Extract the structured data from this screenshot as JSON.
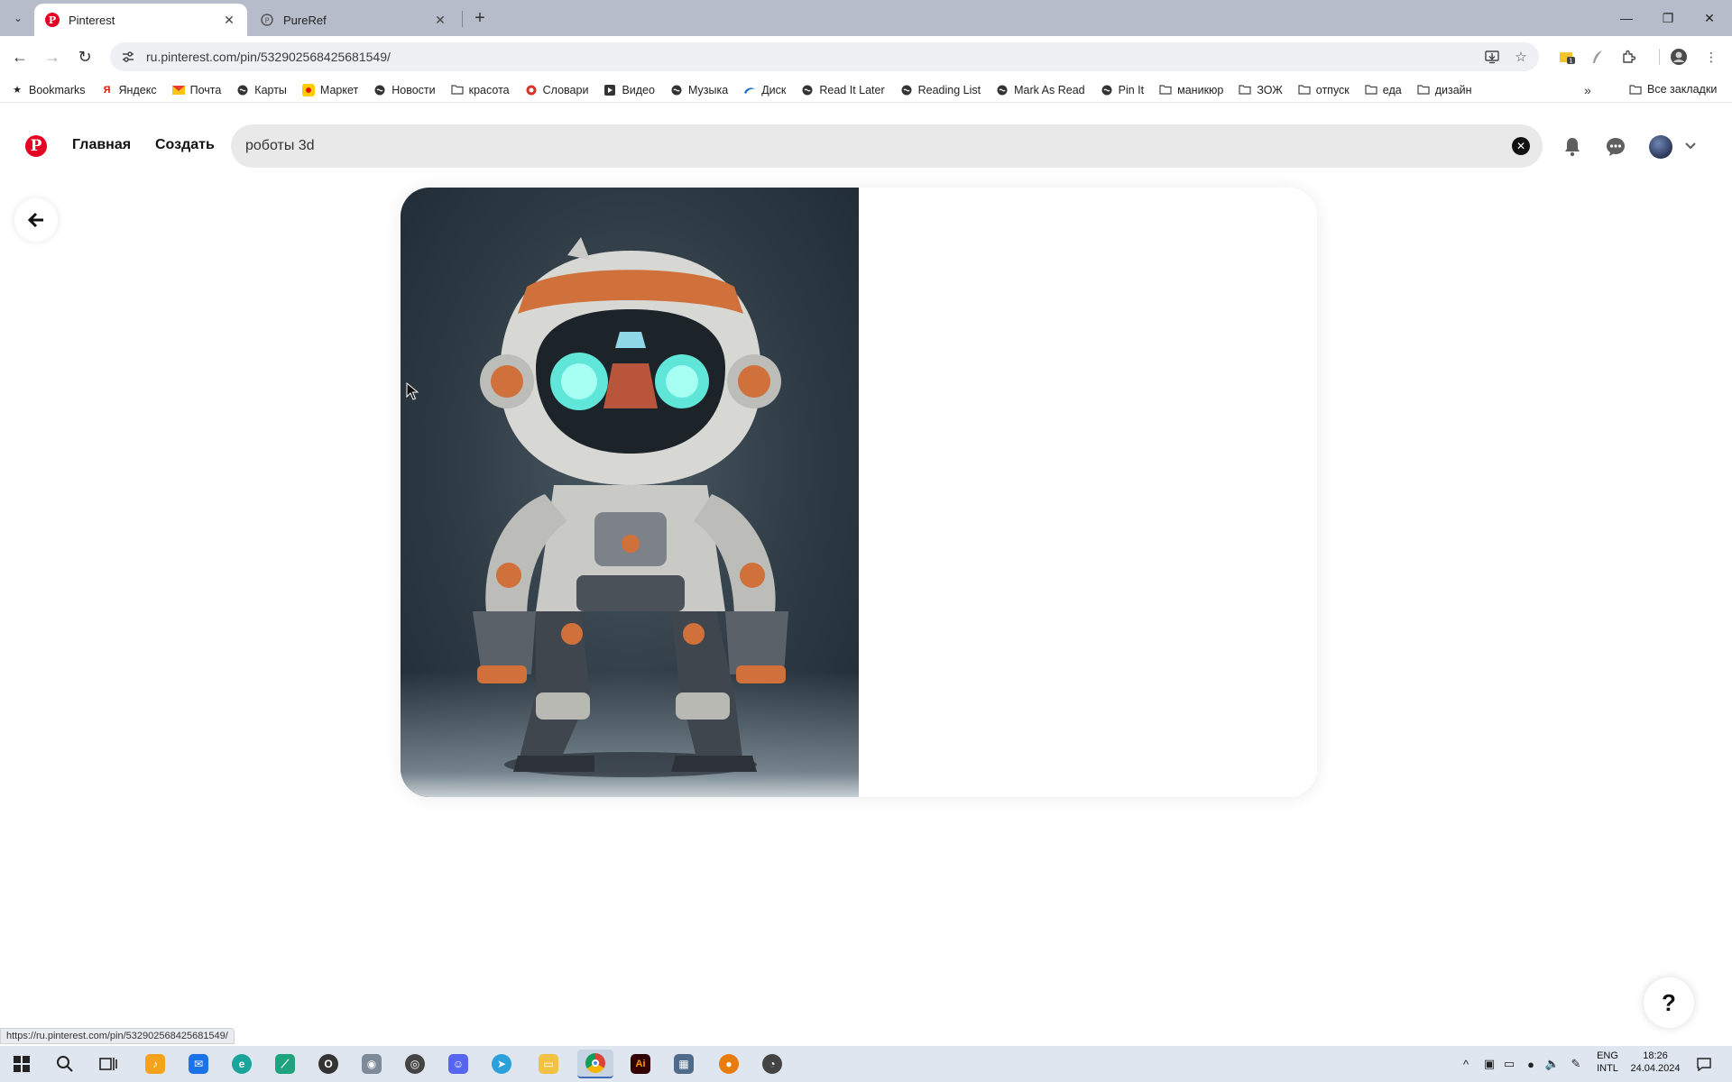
{
  "browser": {
    "tabs": [
      {
        "title": "Pinterest",
        "active": true
      },
      {
        "title": "PureRef",
        "active": false
      }
    ],
    "url": "ru.pinterest.com/pin/532902568425681549/",
    "bookmarks": [
      {
        "label": "Bookmarks",
        "icon": "star-icon"
      },
      {
        "label": "Яндекс",
        "icon": "yandex-icon"
      },
      {
        "label": "Почта",
        "icon": "mail-icon"
      },
      {
        "label": "Карты",
        "icon": "globe-icon"
      },
      {
        "label": "Маркет",
        "icon": "market-icon"
      },
      {
        "label": "Новости",
        "icon": "globe-icon"
      },
      {
        "label": "красота",
        "icon": "folder-icon"
      },
      {
        "label": "Словари",
        "icon": "dictionary-icon"
      },
      {
        "label": "Видео",
        "icon": "video-icon"
      },
      {
        "label": "Музыка",
        "icon": "globe-icon"
      },
      {
        "label": "Диск",
        "icon": "disk-icon"
      },
      {
        "label": "Read It Later",
        "icon": "globe-icon"
      },
      {
        "label": "Reading List",
        "icon": "globe-icon"
      },
      {
        "label": "Mark As Read",
        "icon": "globe-icon"
      },
      {
        "label": "Pin It",
        "icon": "globe-icon"
      },
      {
        "label": "маникюр",
        "icon": "folder-icon"
      },
      {
        "label": "ЗОЖ",
        "icon": "folder-icon"
      },
      {
        "label": "отпуск",
        "icon": "folder-icon"
      },
      {
        "label": "еда",
        "icon": "folder-icon"
      },
      {
        "label": "дизайн",
        "icon": "folder-icon"
      }
    ],
    "bookmarks_all": "Все закладки",
    "status_link": "https://ru.pinterest.com/pin/532902568425681549/"
  },
  "pinterest": {
    "nav_home": "Главная",
    "nav_create": "Создать",
    "search_value": "роботы 3d",
    "brand_color": "#e60023"
  },
  "help": {
    "label": "?"
  },
  "taskbar": {
    "lang_top": "ENG",
    "lang_bottom": "INTL",
    "time": "18:26",
    "date": "24.04.2024"
  }
}
